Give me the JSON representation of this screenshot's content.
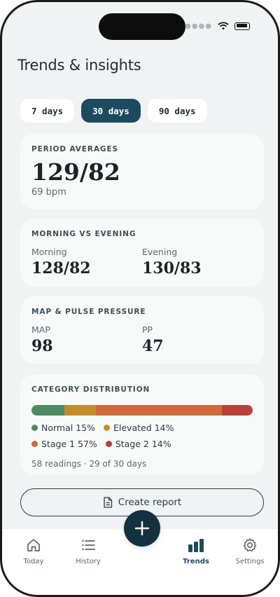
{
  "header": {
    "title": "Trends & insights"
  },
  "tabs": [
    {
      "label": "7 days",
      "active": false
    },
    {
      "label": "30 days",
      "active": true
    },
    {
      "label": "90 days",
      "active": false
    }
  ],
  "period_averages": {
    "title": "PERIOD AVERAGES",
    "bp": "129/82",
    "pulse": "69 bpm"
  },
  "morning_evening": {
    "title": "MORNING VS EVENING",
    "morning_label": "Morning",
    "morning_value": "128/82",
    "evening_label": "Evening",
    "evening_value": "130/83"
  },
  "map_pp": {
    "title": "MAP & PULSE PRESSURE",
    "map_label": "MAP",
    "map_value": "98",
    "pp_label": "PP",
    "pp_value": "47"
  },
  "distribution": {
    "title": "CATEGORY DISTRIBUTION",
    "segments": [
      {
        "name": "Normal",
        "percent": 15,
        "text": "Normal 15%",
        "color": "#4e8a64"
      },
      {
        "name": "Elevated",
        "percent": 14,
        "text": "Elevated 14%",
        "color": "#c48b2c"
      },
      {
        "name": "Stage 1",
        "percent": 57,
        "text": "Stage 1 57%",
        "color": "#cd6a3e"
      },
      {
        "name": "Stage 2",
        "percent": 14,
        "text": "Stage 2 14%",
        "color": "#b7413a"
      }
    ],
    "readings": "58 readings · 29 of 30 days"
  },
  "actions": {
    "create_report": "Create report"
  },
  "tabbar": {
    "items": [
      {
        "label": "Today",
        "icon": "home-icon",
        "active": false
      },
      {
        "label": "History",
        "icon": "list-icon",
        "active": false
      },
      {
        "label": "Trends",
        "icon": "bar-chart-icon",
        "active": true
      },
      {
        "label": "Settings",
        "icon": "gear-icon",
        "active": false
      }
    ],
    "fab_icon": "plus-icon"
  },
  "colors": {
    "accent": "#1e4a5f",
    "fab": "#14313f",
    "background": "#f0f3f3"
  }
}
